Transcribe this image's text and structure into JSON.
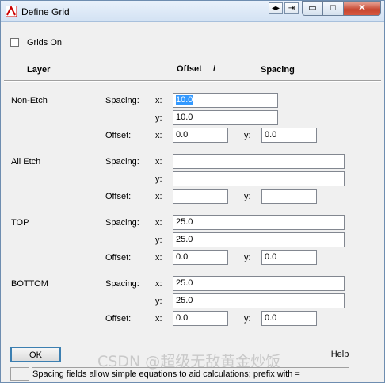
{
  "window": {
    "title": "Define Grid"
  },
  "titlebar": {
    "minimize_glyph": "▭",
    "maximize_glyph": "□",
    "close_glyph": "✕",
    "arrows_glyph": "◂▸",
    "pin_glyph": "⇥"
  },
  "grids_on": {
    "label": "Grids On",
    "checked": false
  },
  "headers": {
    "layer": "Layer",
    "offset": "Offset",
    "slash": "/",
    "spacing": "Spacing"
  },
  "row_labels": {
    "spacing": "Spacing:",
    "offset": "Offset:",
    "x": "x:",
    "y": "y:"
  },
  "layers": [
    {
      "name": "Non-Etch",
      "spacing_x": "10.0",
      "spacing_y": "10.0",
      "offset_x": "0.0",
      "offset_y": "0.0"
    },
    {
      "name": "All Etch",
      "spacing_x": "",
      "spacing_y": "",
      "offset_x": "",
      "offset_y": ""
    },
    {
      "name": "TOP",
      "spacing_x": "25.0",
      "spacing_y": "25.0",
      "offset_x": "0.0",
      "offset_y": "0.0"
    },
    {
      "name": "BOTTOM",
      "spacing_x": "25.0",
      "spacing_y": "25.0",
      "offset_x": "0.0",
      "offset_y": "0.0"
    }
  ],
  "buttons": {
    "ok": "OK",
    "help": "Help"
  },
  "status": "Spacing fields allow simple equations to aid calculations; prefix with =",
  "watermark": "CSDN @超级无敌黄金炒饭"
}
